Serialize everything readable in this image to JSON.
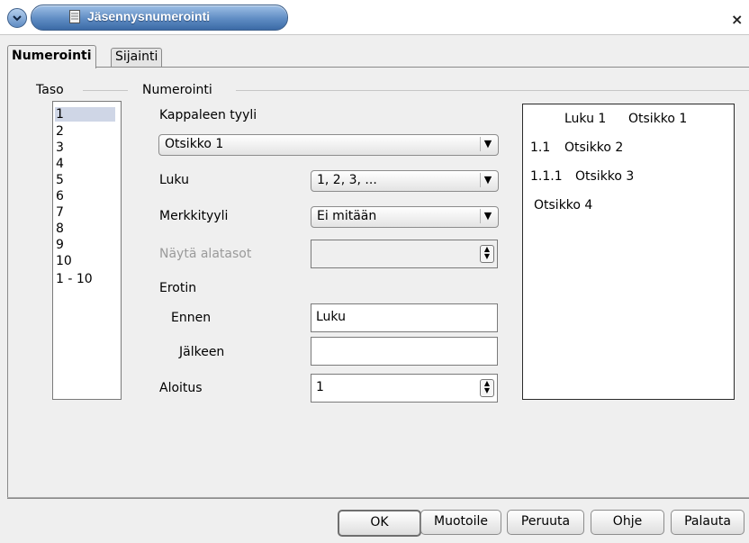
{
  "window": {
    "title": "Jäsennysnumerointi",
    "close_glyph": "×"
  },
  "tabs": [
    {
      "label": "Numerointi",
      "active": true
    },
    {
      "label": "Sijainti",
      "active": false
    }
  ],
  "taso": {
    "legend": "Taso",
    "items": [
      "1",
      "2",
      "3",
      "4",
      "5",
      "6",
      "7",
      "8",
      "9",
      "10",
      "1 - 10"
    ],
    "selected": "1"
  },
  "numerointi": {
    "legend": "Numerointi",
    "kappaleen_tyyli": {
      "label": "Kappaleen tyyli",
      "value": "Otsikko 1"
    },
    "luku": {
      "label": "Luku",
      "value": "1, 2, 3, ..."
    },
    "merkkityyli": {
      "label": "Merkkityyli",
      "value": "Ei mitään"
    },
    "nayta_alatasot": {
      "label": "Näytä alatasot",
      "value": ""
    },
    "erotin": {
      "label": "Erotin"
    },
    "ennen": {
      "label": "Ennen",
      "value": "Luku"
    },
    "jalkeen": {
      "label": "Jälkeen",
      "value": ""
    },
    "aloitus": {
      "label": "Aloitus",
      "value": "1"
    }
  },
  "preview": {
    "lines": [
      {
        "prefix": "Luku 1",
        "text": "Otsikko 1"
      },
      {
        "prefix": "1.1",
        "text": "Otsikko 2"
      },
      {
        "prefix": "1.1.1",
        "text": "Otsikko 3"
      },
      {
        "prefix": "",
        "text": "Otsikko 4"
      }
    ]
  },
  "buttons": {
    "ok": "OK",
    "muotoile": "Muotoile",
    "peruuta": "Peruuta",
    "ohje": "Ohje",
    "palauta": "Palauta"
  },
  "colors": {
    "title_accent": "#5f8cc3",
    "background": "#efefef",
    "selection": "#cfd6e6"
  },
  "icons": {
    "menu": "chevron-down-icon",
    "document": "document-icon",
    "close": "close-icon"
  }
}
